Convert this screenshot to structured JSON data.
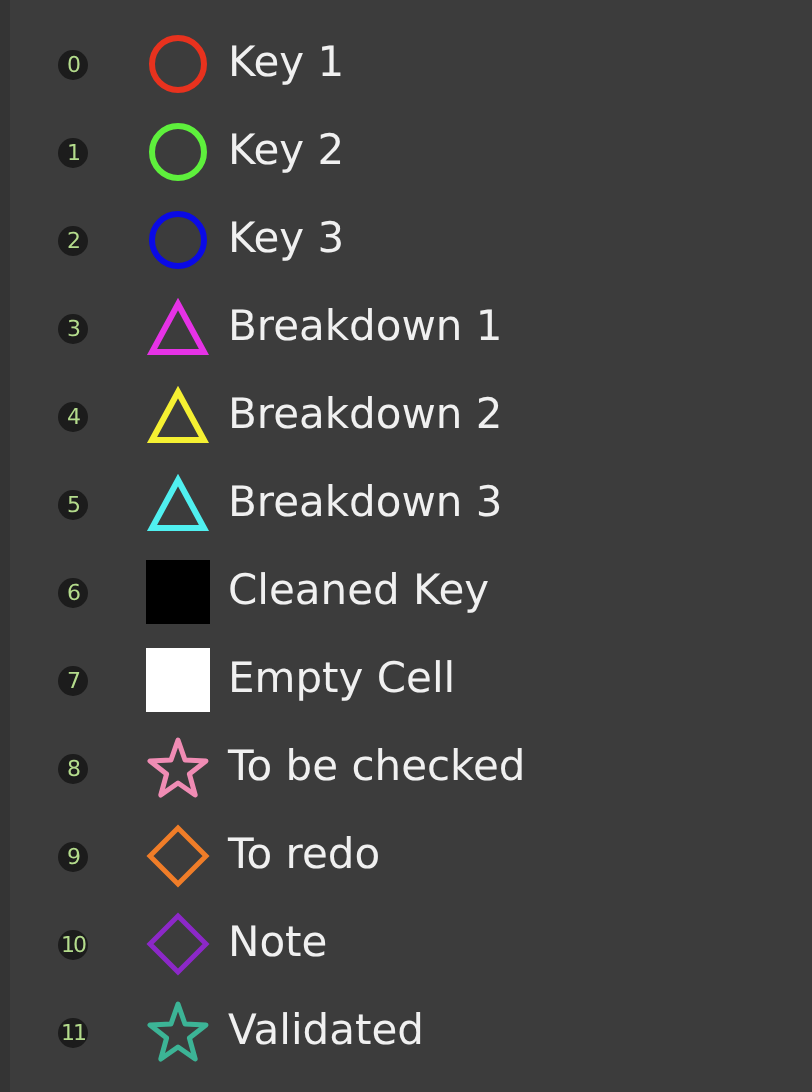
{
  "items": [
    {
      "index": "0",
      "label": "Key 1",
      "kind": "circle",
      "color": "#e8321e"
    },
    {
      "index": "1",
      "label": "Key 2",
      "kind": "circle",
      "color": "#5ef03c"
    },
    {
      "index": "2",
      "label": "Key 3",
      "kind": "circle",
      "color": "#0a0ae6"
    },
    {
      "index": "3",
      "label": "Breakdown 1",
      "kind": "triangle",
      "color": "#e632e6"
    },
    {
      "index": "4",
      "label": "Breakdown 2",
      "kind": "triangle",
      "color": "#f5f032"
    },
    {
      "index": "5",
      "label": "Breakdown 3",
      "kind": "triangle",
      "color": "#50f0f0"
    },
    {
      "index": "6",
      "label": "Cleaned Key",
      "kind": "square",
      "color": "#000000"
    },
    {
      "index": "7",
      "label": "Empty Cell",
      "kind": "square",
      "color": "#ffffff"
    },
    {
      "index": "8",
      "label": "To be checked",
      "kind": "star",
      "color": "#f08cb4"
    },
    {
      "index": "9",
      "label": "To redo",
      "kind": "diamond",
      "color": "#f07d28"
    },
    {
      "index": "10",
      "label": "Note",
      "kind": "diamond",
      "color": "#8c28c8"
    },
    {
      "index": "11",
      "label": "Validated",
      "kind": "star",
      "color": "#3cb496"
    }
  ]
}
